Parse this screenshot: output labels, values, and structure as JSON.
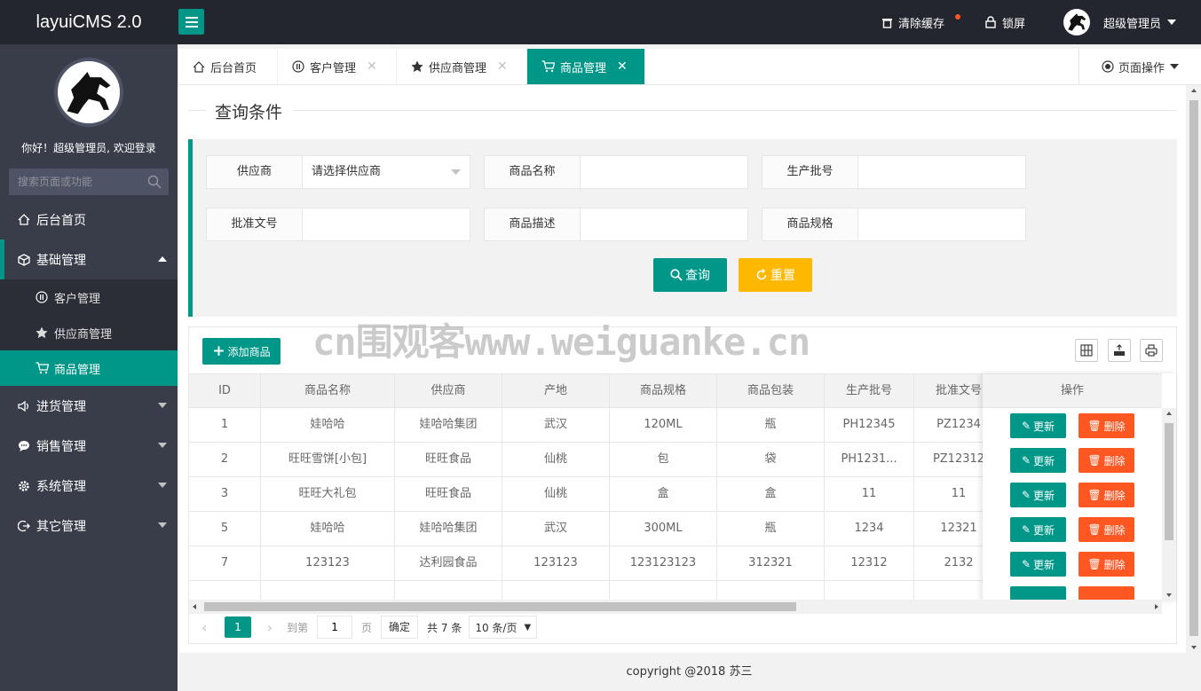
{
  "app": {
    "logo": "layuiCMS 2.0"
  },
  "topbar": {
    "clear_cache": "清除缓存",
    "lock": "锁屏",
    "user": "超级管理员"
  },
  "sidebar": {
    "welcome": "你好！超级管理员, 欢迎登录",
    "search_placeholder": "搜索页面或功能",
    "items": [
      {
        "label": "后台首页"
      },
      {
        "label": "基础管理"
      },
      {
        "label": "客户管理"
      },
      {
        "label": "供应商管理"
      },
      {
        "label": "商品管理"
      },
      {
        "label": "进货管理"
      },
      {
        "label": "销售管理"
      },
      {
        "label": "系统管理"
      },
      {
        "label": "其它管理"
      }
    ]
  },
  "tabs": [
    {
      "label": "后台首页"
    },
    {
      "label": "客户管理"
    },
    {
      "label": "供应商管理"
    },
    {
      "label": "商品管理"
    }
  ],
  "page_op": "页面操作",
  "query": {
    "legend": "查询条件",
    "supplier_label": "供应商",
    "supplier_value": "请选择供应商",
    "name_label": "商品名称",
    "batch_label": "生产批号",
    "approval_label": "批准文号",
    "desc_label": "商品描述",
    "spec_label": "商品规格",
    "search_btn": "查询",
    "reset_btn": "重置"
  },
  "table": {
    "add_btn": "添加商品",
    "columns": [
      "ID",
      "商品名称",
      "供应商",
      "产地",
      "商品规格",
      "商品包装",
      "生产批号",
      "批准文号",
      "操作"
    ],
    "rows": [
      [
        "1",
        "娃哈哈",
        "娃哈哈集团",
        "武汉",
        "120ML",
        "瓶",
        "PH12345",
        "PZ1234"
      ],
      [
        "2",
        "旺旺雪饼[小包]",
        "旺旺食品",
        "仙桃",
        "包",
        "袋",
        "PH1231...",
        "PZ12312"
      ],
      [
        "3",
        "旺旺大礼包",
        "旺旺食品",
        "仙桃",
        "盒",
        "盒",
        "11",
        "11"
      ],
      [
        "5",
        "娃哈哈",
        "娃哈哈集团",
        "武汉",
        "300ML",
        "瓶",
        "1234",
        "12321"
      ],
      [
        "7",
        "123123",
        "达利园食品",
        "123123",
        "123123123",
        "312321",
        "12312",
        "2132"
      ]
    ],
    "edit_label": "更新",
    "delete_label": "删除"
  },
  "pager": {
    "current": "1",
    "goto_prefix": "到第",
    "goto_value": "1",
    "goto_suffix": "页",
    "confirm": "确定",
    "total": "共 7 条",
    "page_size": "10 条/页"
  },
  "footer": {
    "copyright": "copyright @2018 苏三"
  },
  "watermark": "cn围观客www.weiguanke.cn",
  "colors": {
    "accent": "#009688",
    "warn": "#ffb800",
    "danger": "#ff5722",
    "dark": "#23262e",
    "sidebar": "#393d49"
  }
}
